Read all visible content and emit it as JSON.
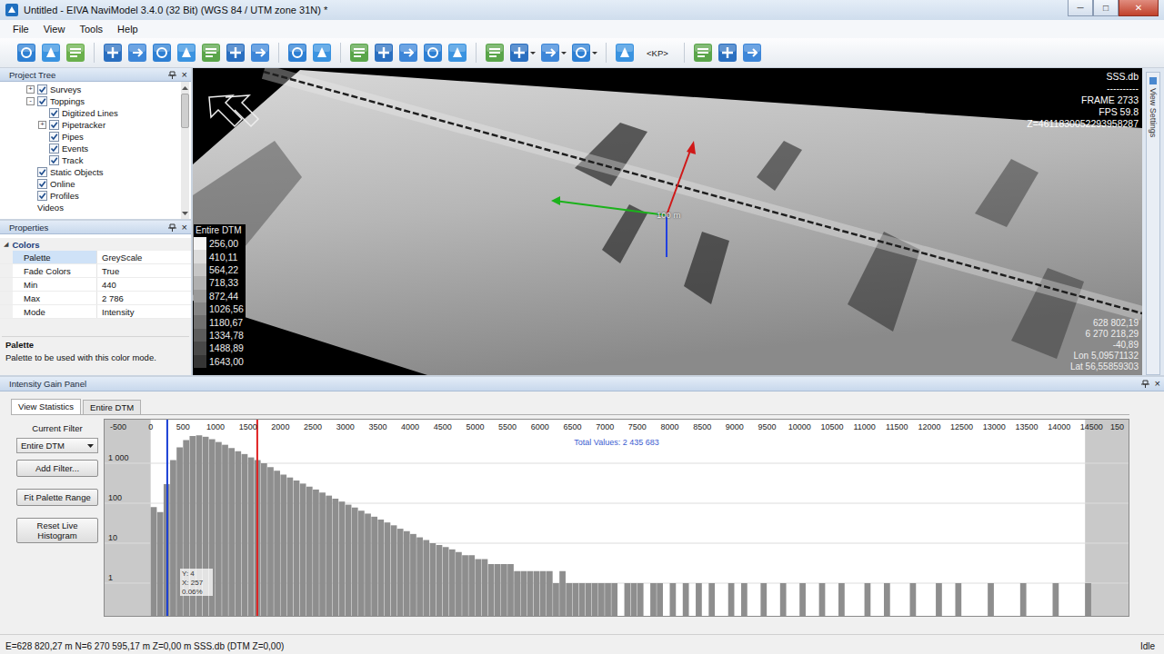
{
  "window": {
    "title": "Untitled - EIVA NaviModel 3.4.0 (32 Bit) (WGS 84 / UTM zone 31N) *",
    "buttons": [
      "─",
      "□",
      "✕"
    ]
  },
  "menu": [
    "File",
    "View",
    "Tools",
    "Help"
  ],
  "toolbar": [
    {
      "kind": "button",
      "dropdown": false
    },
    {
      "kind": "button",
      "dropdown": false
    },
    {
      "kind": "button",
      "dropdown": false
    },
    {
      "kind": "separator"
    },
    {
      "kind": "button",
      "dropdown": false
    },
    {
      "kind": "button",
      "dropdown": false
    },
    {
      "kind": "button",
      "dropdown": false
    },
    {
      "kind": "button",
      "dropdown": false
    },
    {
      "kind": "button",
      "dropdown": false
    },
    {
      "kind": "button",
      "dropdown": false
    },
    {
      "kind": "button",
      "dropdown": false
    },
    {
      "kind": "separator"
    },
    {
      "kind": "button",
      "dropdown": false
    },
    {
      "kind": "button",
      "dropdown": false
    },
    {
      "kind": "separator"
    },
    {
      "kind": "button",
      "dropdown": false
    },
    {
      "kind": "button",
      "dropdown": false
    },
    {
      "kind": "button",
      "dropdown": false
    },
    {
      "kind": "button",
      "dropdown": false
    },
    {
      "kind": "button",
      "dropdown": false
    },
    {
      "kind": "separator"
    },
    {
      "kind": "button",
      "dropdown": false
    },
    {
      "kind": "button",
      "dropdown": true
    },
    {
      "kind": "button",
      "dropdown": true
    },
    {
      "kind": "button",
      "dropdown": true
    },
    {
      "kind": "separator"
    },
    {
      "kind": "button",
      "dropdown": false
    },
    {
      "kind": "label",
      "text": "<KP>"
    },
    {
      "kind": "separator"
    },
    {
      "kind": "button",
      "dropdown": false
    },
    {
      "kind": "button",
      "dropdown": false
    },
    {
      "kind": "button",
      "dropdown": false
    }
  ],
  "project_tree": {
    "title": "Project Tree",
    "close": "×",
    "items": [
      {
        "label": "Surveys",
        "level": 0,
        "kind": "check",
        "checked": true,
        "expander": "+"
      },
      {
        "label": "Toppings",
        "level": 0,
        "kind": "check",
        "checked": true,
        "expander": "-"
      },
      {
        "label": "Digitized Lines",
        "level": 1,
        "kind": "check",
        "checked": true
      },
      {
        "label": "Pipetracker",
        "level": 1,
        "kind": "check",
        "checked": true,
        "expander": "+"
      },
      {
        "label": "Pipes",
        "level": 1,
        "kind": "check",
        "checked": true
      },
      {
        "label": "Events",
        "level": 1,
        "kind": "check",
        "checked": true
      },
      {
        "label": "Track",
        "level": 1,
        "kind": "check",
        "checked": true
      },
      {
        "label": "Static Objects",
        "level": 0,
        "kind": "check",
        "checked": true
      },
      {
        "label": "Online",
        "level": 0,
        "kind": "check",
        "checked": true
      },
      {
        "label": "Profiles",
        "level": 0,
        "kind": "check",
        "checked": true
      },
      {
        "label": "Videos",
        "level": 0,
        "kind": "plain"
      }
    ]
  },
  "properties": {
    "title": "Properties",
    "close": "×",
    "category": "Colors",
    "category_glyph": "◢",
    "rows": [
      {
        "name": "Palette",
        "value": "GreyScale",
        "selected": true
      },
      {
        "name": "Fade Colors",
        "value": "True",
        "selected": false
      },
      {
        "name": "Min",
        "value": "440",
        "selected": false
      },
      {
        "name": "Max",
        "value": "2 786",
        "selected": false
      },
      {
        "name": "Mode",
        "value": "Intensity",
        "selected": false
      }
    ],
    "description_title": "Palette",
    "description": "Palette to be used with this color mode."
  },
  "view3d": {
    "overlay_top": [
      "SSS.db",
      "----------",
      "FRAME 2733",
      "FPS 59.8",
      "Z=4611830052293958287"
    ],
    "overlay_bottom": [
      "628 802,19",
      "6 270 218,29",
      "-40,89",
      "Lon 5,09571132",
      "Lat 56,55859303"
    ],
    "scale_label": "100 m",
    "legend": {
      "title": "Entire DTM",
      "entries": [
        {
          "label": "256,00",
          "color": "#f4f4f4"
        },
        {
          "label": "410,11",
          "color": "#dcdcdc"
        },
        {
          "label": "564,22",
          "color": "#c6c6c6"
        },
        {
          "label": "718,33",
          "color": "#b0b0b0"
        },
        {
          "label": "872,44",
          "color": "#9a9a9a"
        },
        {
          "label": "1026,56",
          "color": "#858585"
        },
        {
          "label": "1180,67",
          "color": "#707070"
        },
        {
          "label": "1334,78",
          "color": "#5c5c5c"
        },
        {
          "label": "1488,89",
          "color": "#484848"
        },
        {
          "label": "1643,00",
          "color": "#353535"
        }
      ]
    },
    "side_tab": "View Settings"
  },
  "gain_panel": {
    "title": "Intensity Gain Panel",
    "close": "×",
    "tabs": [
      {
        "label": "View Statistics",
        "selected": true
      },
      {
        "label": "Entire DTM",
        "selected": false
      }
    ],
    "filter_label": "Current Filter",
    "filter_value": "Entire DTM",
    "buttons": [
      "Add Filter...",
      "Fit Palette Range",
      "Reset Live Histogram"
    ],
    "chart": {
      "total": "Total Values: 2 435 683",
      "x_ticks": [
        {
          "label": "-500",
          "value": -500
        },
        {
          "label": "0",
          "value": 0
        },
        {
          "label": "500",
          "value": 500
        },
        {
          "label": "1000",
          "value": 1000
        },
        {
          "label": "1500",
          "value": 1500
        },
        {
          "label": "2000",
          "value": 2000
        },
        {
          "label": "2500",
          "value": 2500
        },
        {
          "label": "3000",
          "value": 3000
        },
        {
          "label": "3500",
          "value": 3500
        },
        {
          "label": "4000",
          "value": 4000
        },
        {
          "label": "4500",
          "value": 4500
        },
        {
          "label": "5000",
          "value": 5000
        },
        {
          "label": "5500",
          "value": 5500
        },
        {
          "label": "6000",
          "value": 6000
        },
        {
          "label": "6500",
          "value": 6500
        },
        {
          "label": "7000",
          "value": 7000
        },
        {
          "label": "7500",
          "value": 7500
        },
        {
          "label": "8000",
          "value": 8000
        },
        {
          "label": "8500",
          "value": 8500
        },
        {
          "label": "9000",
          "value": 9000
        },
        {
          "label": "9500",
          "value": 9500
        },
        {
          "label": "10000",
          "value": 10000
        },
        {
          "label": "10500",
          "value": 10500
        },
        {
          "label": "11000",
          "value": 11000
        },
        {
          "label": "11500",
          "value": 11500
        },
        {
          "label": "12000",
          "value": 12000
        },
        {
          "label": "12500",
          "value": 12500
        },
        {
          "label": "13000",
          "value": 13000
        },
        {
          "label": "13500",
          "value": 13500
        },
        {
          "label": "14000",
          "value": 14000
        },
        {
          "label": "14500",
          "value": 14500
        },
        {
          "label": "150",
          "value": 15000
        }
      ],
      "y_ticks": [
        {
          "label": "1 000",
          "value": 1000
        },
        {
          "label": "100",
          "value": 100
        },
        {
          "label": "10",
          "value": 10
        },
        {
          "label": "1",
          "value": 1
        }
      ],
      "bin_start": 0,
      "bin_width": 100,
      "counts": [
        80,
        60,
        300,
        1200,
        2500,
        3800,
        4800,
        5000,
        4600,
        4000,
        3400,
        2900,
        2400,
        2000,
        1700,
        1400,
        1200,
        1000,
        800,
        650,
        520,
        440,
        370,
        310,
        260,
        220,
        185,
        155,
        130,
        110,
        92,
        78,
        65,
        55,
        46,
        39,
        33,
        28,
        23,
        20,
        17,
        14,
        12,
        10,
        9,
        8,
        7,
        6,
        5,
        5,
        4,
        4,
        3,
        3,
        3,
        3,
        2,
        2,
        2,
        2,
        2,
        2,
        1,
        2,
        1,
        1,
        1,
        1,
        1,
        1,
        1,
        1,
        0,
        1,
        1,
        1,
        0,
        1,
        1,
        0,
        1,
        0,
        1,
        0,
        1,
        0,
        1,
        0,
        0,
        1,
        0,
        1,
        0,
        0,
        1,
        0,
        0,
        1,
        0,
        0,
        1,
        0,
        0,
        1,
        0,
        0,
        1,
        0,
        0,
        0,
        1,
        0,
        0,
        1,
        0,
        0,
        0,
        1,
        0,
        0,
        0,
        1,
        0,
        0,
        1,
        0,
        0,
        0,
        0,
        1,
        0,
        0,
        0,
        0,
        1,
        0,
        0,
        0,
        0,
        1,
        0,
        0,
        0,
        0,
        1
      ],
      "data_range": [
        0,
        14400
      ],
      "markers": [
        {
          "value": 256,
          "color": "#1a3fd6"
        },
        {
          "value": 1643,
          "color": "#e02020"
        }
      ],
      "tooltip": {
        "value": 257,
        "lines": [
          "Y: 4",
          "X: 257",
          "0.06%"
        ]
      }
    }
  },
  "status_bar": {
    "text": "E=628 820,27 m N=6 270 595,17 m Z=0,00 m SSS.db (DTM Z=0,00)",
    "state": "Idle"
  }
}
